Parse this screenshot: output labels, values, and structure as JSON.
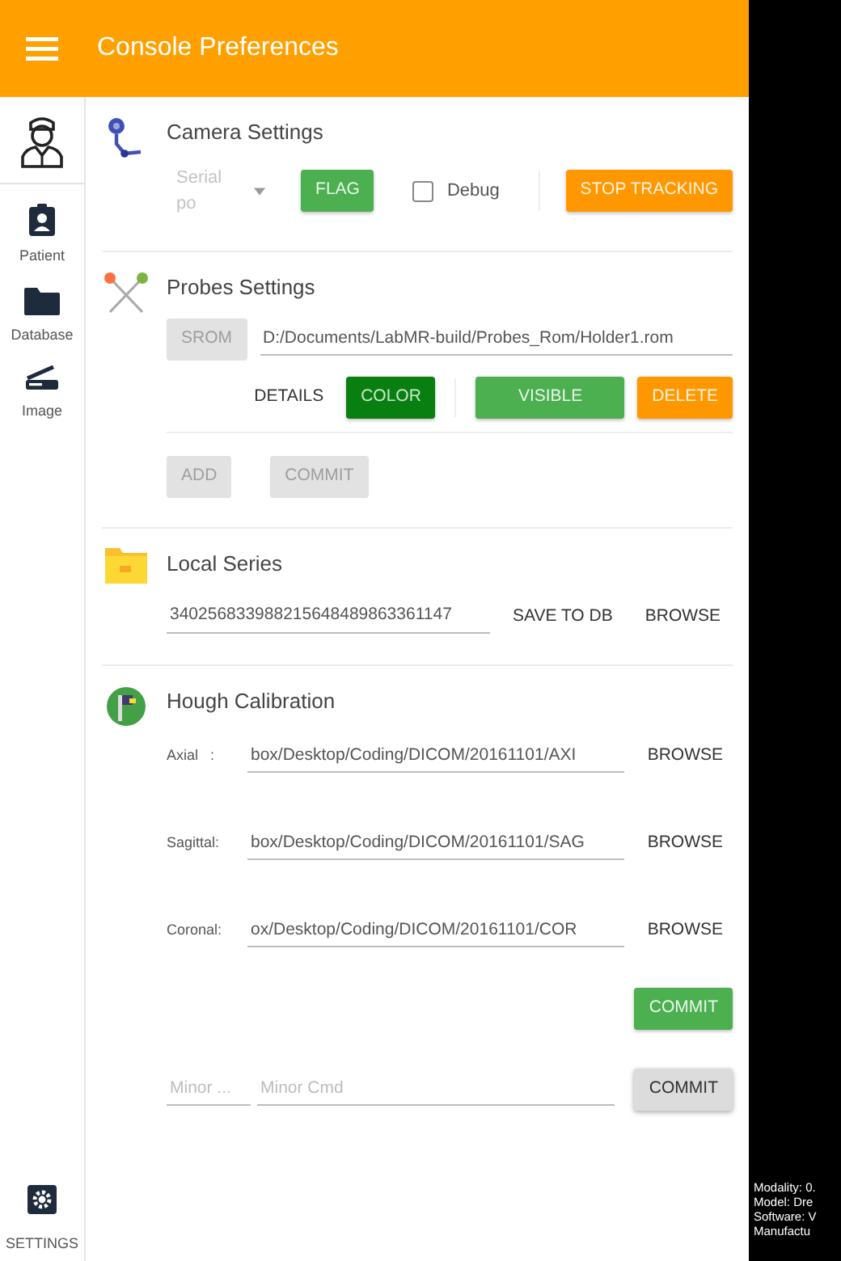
{
  "app_bar": {
    "title": "Console Preferences"
  },
  "sidebar": {
    "items": [
      {
        "label": "Patient",
        "kind": "patient"
      },
      {
        "label": "Database",
        "kind": "database"
      },
      {
        "label": "Image",
        "kind": "image"
      }
    ],
    "settings": {
      "label": "SETTINGS"
    }
  },
  "camera_settings": {
    "title": "Camera Settings",
    "port_select": {
      "placeholder": "Serial po"
    },
    "flag_button": {
      "label": "FLAG",
      "kind": "success"
    },
    "debug": {
      "label": "Debug",
      "checked": false
    },
    "stop_button": {
      "label": "STOP TRACKING",
      "kind": "warning"
    }
  },
  "probes_settings": {
    "title": "Probes Settings",
    "srom_button": {
      "label": "SROM",
      "kind": "disabled"
    },
    "path": "D:/Documents/LabMR-build/Probes_Rom/Holder1.rom",
    "probe_buttons": [
      {
        "label": "DETAILS",
        "kind": "flat"
      },
      {
        "label": "COLOR",
        "kind": "dark"
      },
      {
        "label": "VISIBLE",
        "kind": "success"
      },
      {
        "label": "DELETE",
        "kind": "warning"
      }
    ],
    "bottom_buttons": [
      {
        "label": "ADD",
        "kind": "disabled"
      },
      {
        "label": "COMMIT",
        "kind": "disabled"
      }
    ]
  },
  "local_series": {
    "title": "Local Series",
    "series_id": "340256833988215648489863361147",
    "buttons": [
      {
        "label": "SAVE TO DB",
        "kind": "flat"
      },
      {
        "label": "BROWSE",
        "kind": "flat"
      }
    ]
  },
  "hough_calibration": {
    "title": "Hough Calibration",
    "paths": [
      {
        "label": "Axial   :",
        "value": "box/Desktop/Coding/DICOM/20161101/AXI",
        "button": {
          "label": "BROWSE",
          "kind": "flat"
        }
      },
      {
        "label": "Sagittal:",
        "value": "box/Desktop/Coding/DICOM/20161101/SAG",
        "button": {
          "label": "BROWSE",
          "kind": "flat"
        }
      },
      {
        "label": "Coronal:",
        "value": "ox/Desktop/Coding/DICOM/20161101/COR",
        "button": {
          "label": "BROWSE",
          "kind": "flat"
        }
      }
    ],
    "commit_button": {
      "label": "COMMIT",
      "kind": "success"
    },
    "minor_field": {
      "placeholder": "Minor ..."
    },
    "minor_cmd_field": {
      "placeholder": "Minor Cmd"
    },
    "minor_commit_button": {
      "label": "COMMIT",
      "kind": "raised"
    }
  },
  "side_panel": {
    "lines": [
      "Modality: 0.",
      "Model: Dre",
      "Software: V",
      "Manufactu"
    ]
  }
}
